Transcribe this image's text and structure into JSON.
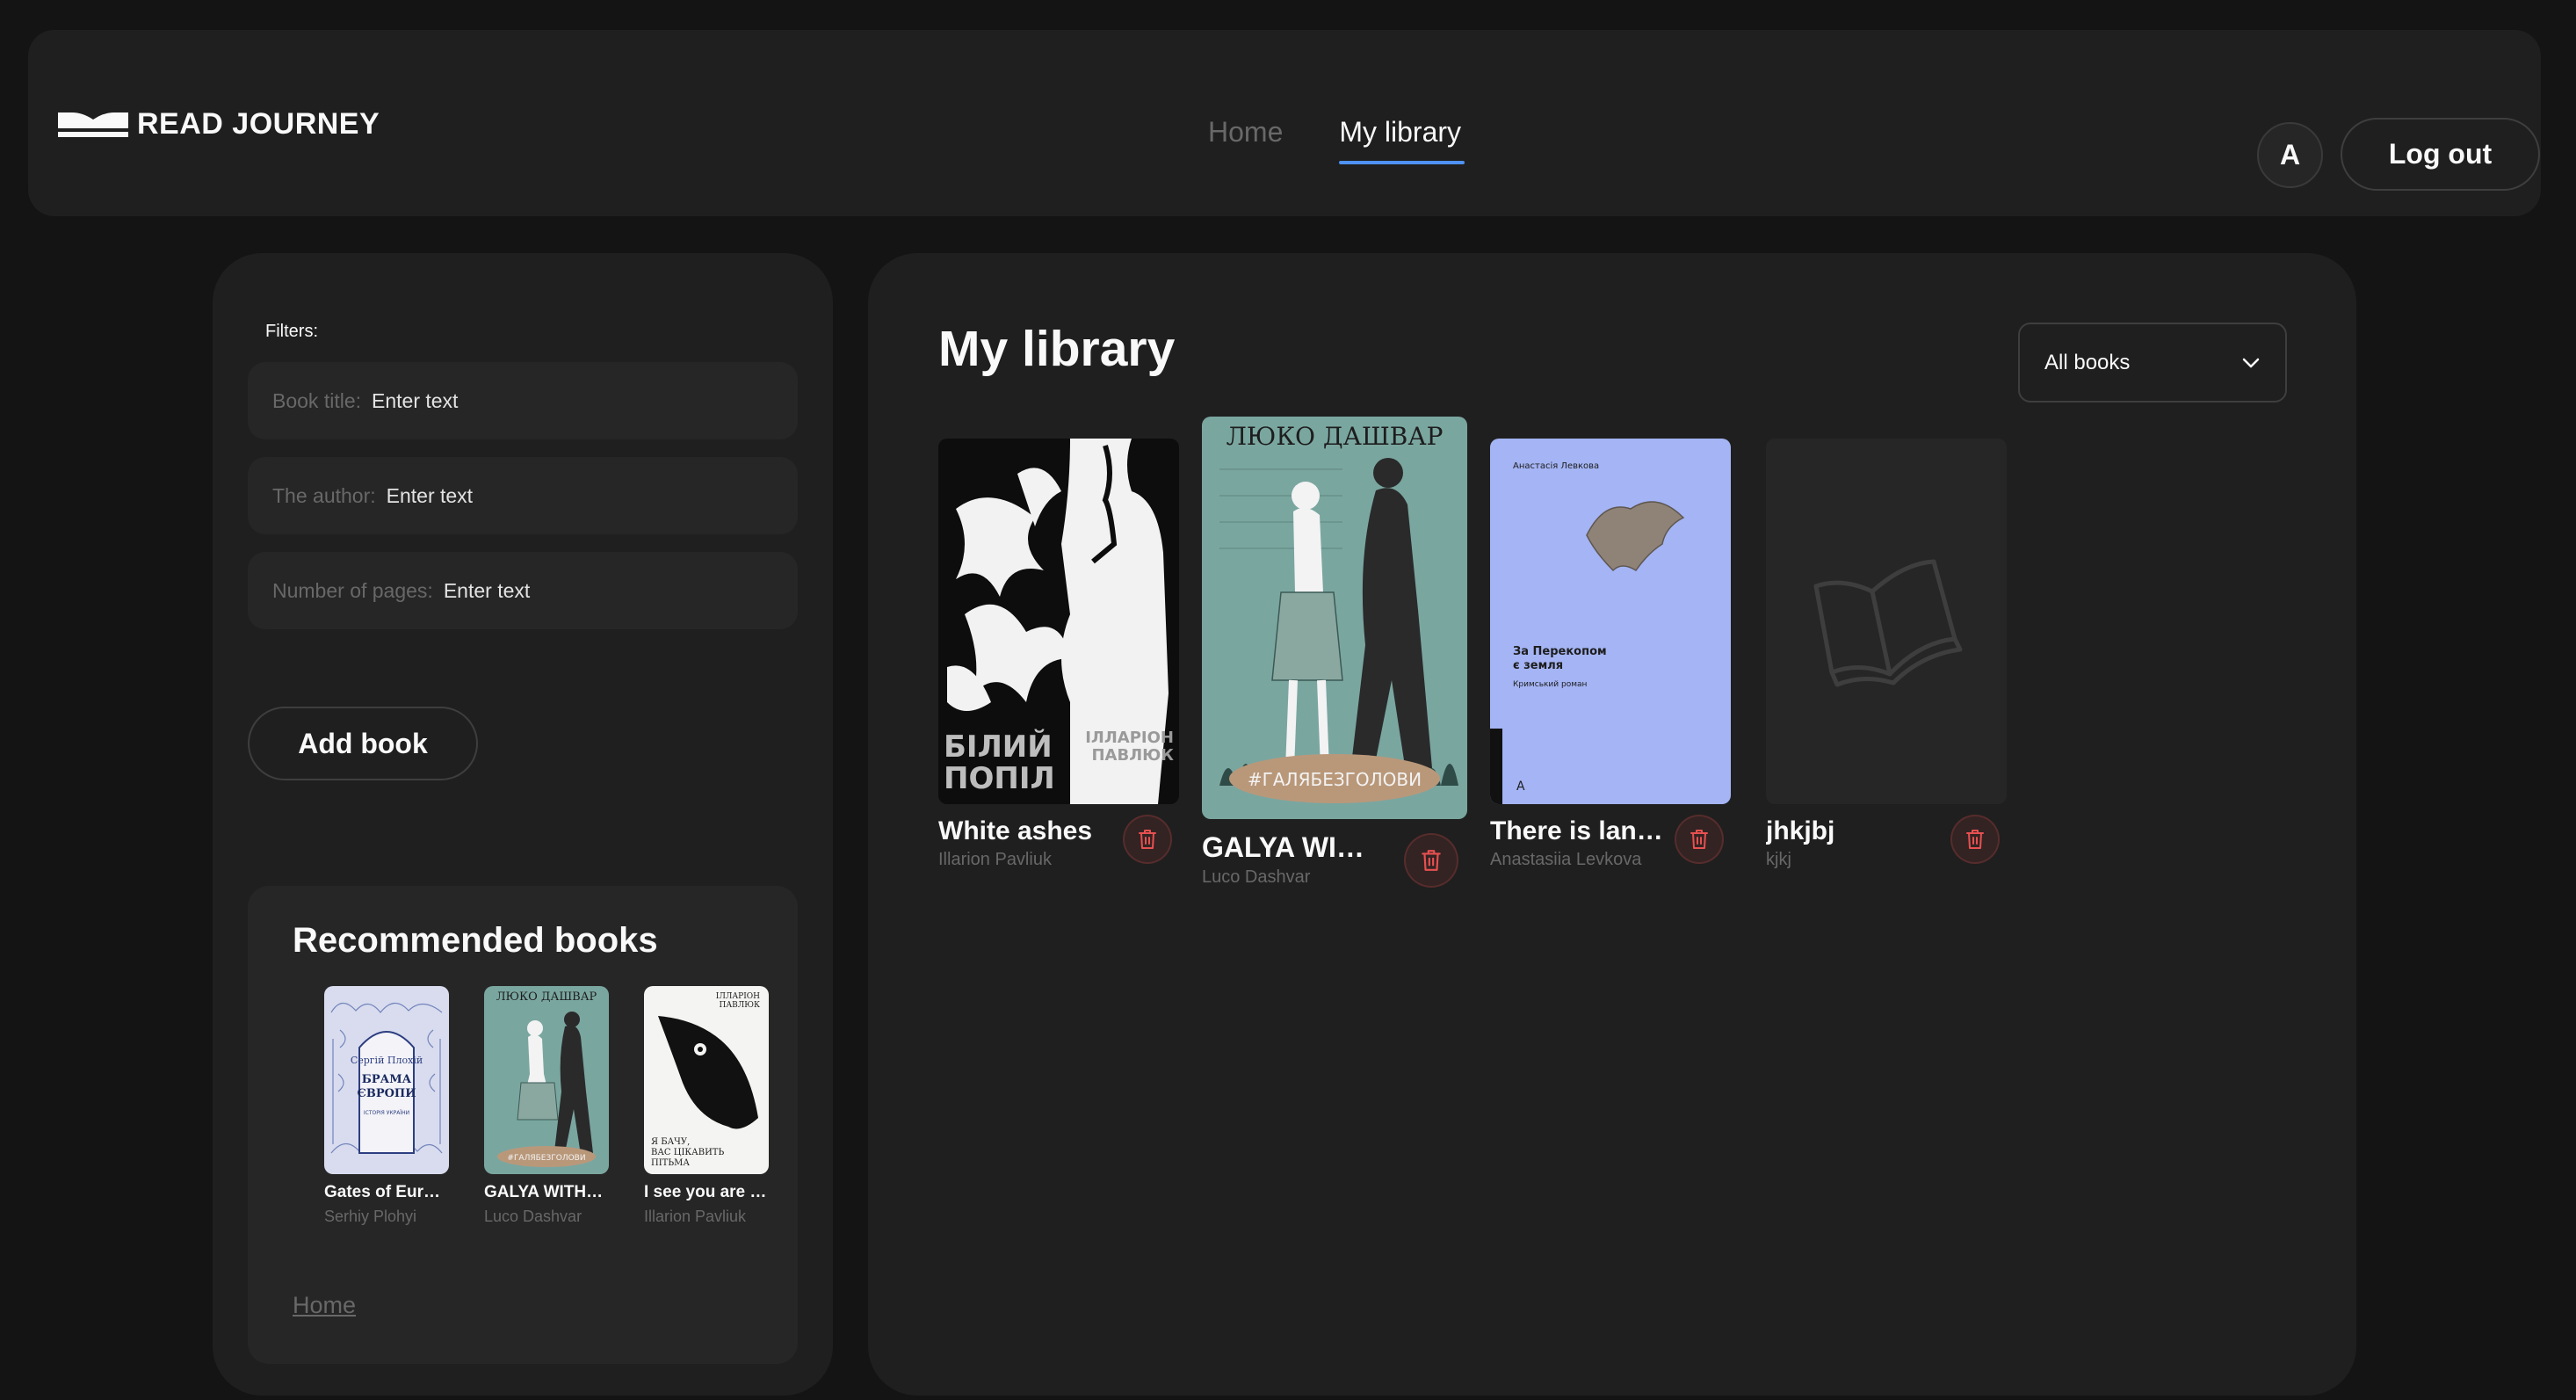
{
  "header": {
    "logo_text": "READ JOURNEY",
    "nav": [
      {
        "label": "Home",
        "active": false
      },
      {
        "label": "My library",
        "active": true
      }
    ],
    "avatar_initial": "A",
    "logout_label": "Log out"
  },
  "filters": {
    "label": "Filters:",
    "fields": [
      {
        "label": "Book title:",
        "placeholder": "Enter text"
      },
      {
        "label": "The author:",
        "placeholder": "Enter text"
      },
      {
        "label": "Number of pages:",
        "placeholder": "Enter text"
      }
    ],
    "add_button": "Add book"
  },
  "recommended": {
    "title": "Recommended books",
    "books": [
      {
        "title": "Gates of Eur…",
        "author": "Serhiy Plohyi",
        "cover_text": "БРАМА ЄВРОПИ"
      },
      {
        "title": "GALYA WITH…",
        "author": "Luco Dashvar",
        "cover_text": "ЛЮКО ДАШВАР"
      },
      {
        "title": "I see you are …",
        "author": "Illarion Pavliuk",
        "cover_text": "ІЛЛАРІОН ПАВЛЮК"
      }
    ],
    "home_link": "Home"
  },
  "library": {
    "title": "My library",
    "filter_value": "All books",
    "books": [
      {
        "title": "White ashes",
        "author": "Illarion Pavliuk",
        "cover_text": "БІЛИЙ ПОПІЛ"
      },
      {
        "title": "GALYA WIT…",
        "author": "Luco Dashvar",
        "cover_text": "ЛЮКО ДАШВАР"
      },
      {
        "title": "There is lan…",
        "author": "Anastasiia Levkova",
        "cover_text": "За Перекопом є земля"
      },
      {
        "title": "jhkjbj",
        "author": "kjkj",
        "cover_text": ""
      }
    ]
  },
  "colors": {
    "background": "#141414",
    "panel": "#1f1f1f",
    "field": "#262626",
    "muted_text": "#686868",
    "accent": "#4f92f7",
    "delete": "#e85050"
  }
}
